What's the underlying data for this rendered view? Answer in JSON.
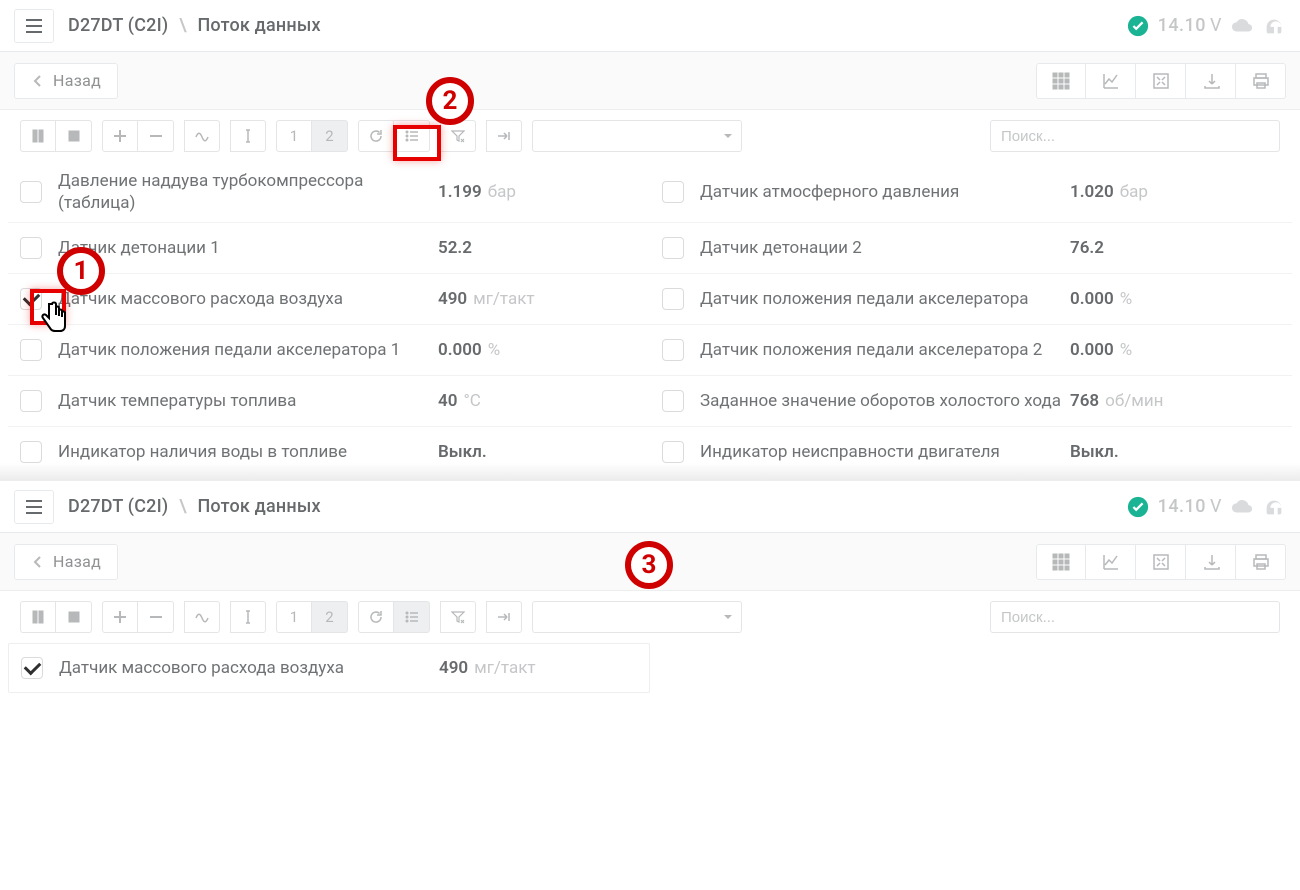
{
  "header": {
    "device": "D27DT (C2I)",
    "section": "Поток данных",
    "voltage_value": "14.10",
    "voltage_unit": "V"
  },
  "nav": {
    "back": "Назад"
  },
  "toolbar": {
    "col1": "1",
    "col2": "2",
    "search_placeholder": "Поиск..."
  },
  "rows": [
    {
      "l_name": "Давление наддува турбокомпрессора (таблица)",
      "l_val": "1.199",
      "l_unit": "бар",
      "r_name": "Датчик атмосферного давления",
      "r_val": "1.020",
      "r_unit": "бар"
    },
    {
      "l_name": "Датчик детонации 1",
      "l_val": "52.2",
      "l_unit": "",
      "r_name": "Датчик детонации 2",
      "r_val": "76.2",
      "r_unit": ""
    },
    {
      "l_name": "Датчик массового расхода воздуха",
      "l_val": "490",
      "l_unit": "мг/такт",
      "r_name": "Датчик положения педали акселератора",
      "r_val": "0.000",
      "r_unit": "%"
    },
    {
      "l_name": "Датчик положения педали акселератора 1",
      "l_val": "0.000",
      "l_unit": "%",
      "r_name": "Датчик положения педали акселератора 2",
      "r_val": "0.000",
      "r_unit": "%"
    },
    {
      "l_name": "Датчик температуры топлива",
      "l_val": "40",
      "l_unit": "°C",
      "r_name": "Заданное значение оборотов холостого хода",
      "r_val": "768",
      "r_unit": "об/мин"
    },
    {
      "l_name": "Индикатор наличия воды в топливе",
      "l_val": "Выкл.",
      "l_unit": "",
      "r_name": "Индикатор неисправности двигателя",
      "r_val": "Выкл.",
      "r_unit": ""
    }
  ],
  "filtered_row": {
    "name": "Датчик массового расхода воздуха",
    "val": "490",
    "unit": "мг/такт"
  },
  "callouts": {
    "c1": "1",
    "c2": "2",
    "c3": "3"
  }
}
